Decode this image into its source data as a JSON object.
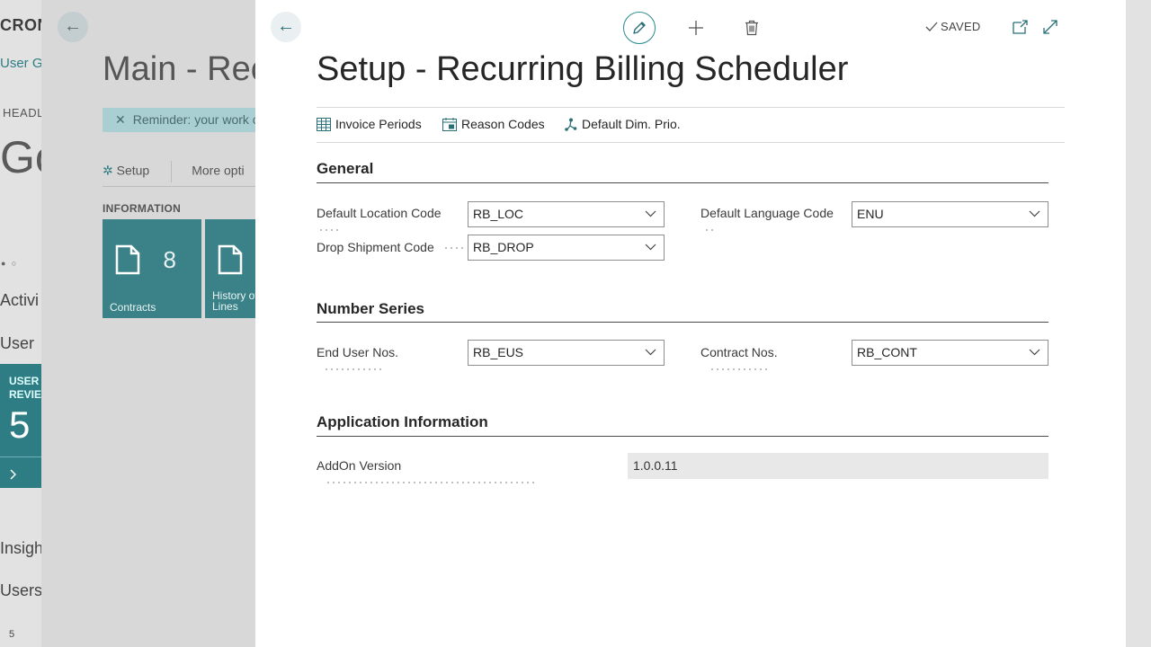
{
  "role_center": {
    "company": "CRON",
    "user_link": "User G",
    "headline_label": "HEADL",
    "greeting": "Go",
    "activities_label": "Activi",
    "user_label": "User",
    "tile_title_1": "USER",
    "tile_title_2": "REVIE",
    "tile_value": "5",
    "insights_label": "Insigh",
    "users_label": "Users",
    "bottom_value": "5"
  },
  "main_page": {
    "title": "Main - Rec",
    "reminder": "Reminder: your work c",
    "action_setup": "Setup",
    "action_more": "More opti",
    "info_header": "INFORMATION",
    "tiles": [
      {
        "label": "Contracts",
        "count": "8"
      },
      {
        "label_line1": "History of",
        "label_line2": "Lines"
      }
    ]
  },
  "dialog": {
    "status": "SAVED",
    "title": "Setup - Recurring Billing Scheduler",
    "actions": [
      "Invoice Periods",
      "Reason Codes",
      "Default Dim. Prio."
    ],
    "sections": {
      "general": {
        "header": "General",
        "fields": {
          "default_location_code": {
            "label": "Default Location Code",
            "value": "RB_LOC"
          },
          "drop_shipment_code": {
            "label": "Drop Shipment Code",
            "value": "RB_DROP"
          },
          "default_language_code": {
            "label": "Default Language Code",
            "value": "ENU"
          }
        }
      },
      "number_series": {
        "header": "Number Series",
        "fields": {
          "end_user_nos": {
            "label": "End User Nos.",
            "value": "RB_EUS"
          },
          "contract_nos": {
            "label": "Contract Nos.",
            "value": "RB_CONT"
          }
        }
      },
      "application_information": {
        "header": "Application Information",
        "fields": {
          "addon_version": {
            "label": "AddOn Version",
            "value": "1.0.0.11"
          }
        }
      }
    }
  },
  "colors": {
    "accent": "#2a8a91",
    "tile": "#3a8288",
    "dialog_bg": "#ffffff",
    "readonly_bg": "#e8e8e8"
  },
  "icons": [
    "back-arrow-icon",
    "edit-pencil-icon",
    "plus-icon",
    "trash-icon",
    "checkmark-icon",
    "open-new-window-icon",
    "expand-icon",
    "table-icon",
    "calendar-icon",
    "dimension-icon",
    "chevron-down-icon",
    "document-icon",
    "close-icon",
    "gear-icon",
    "chevron-right-icon"
  ]
}
